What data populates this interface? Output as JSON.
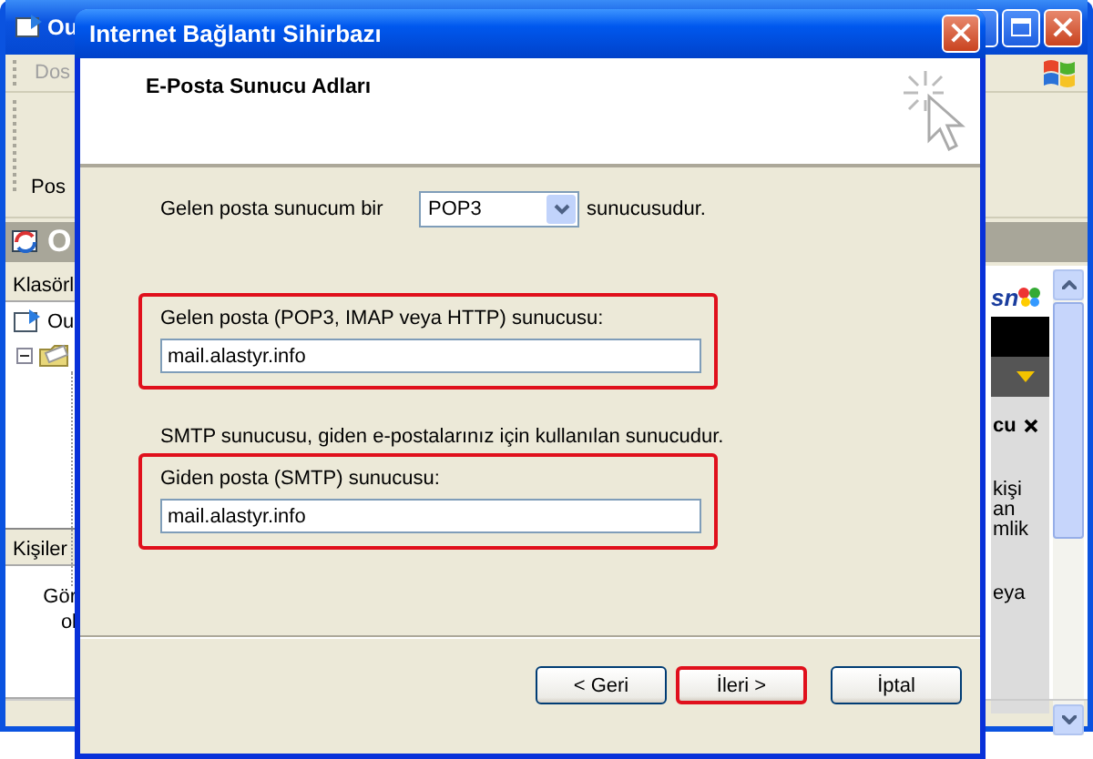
{
  "background_window": {
    "title": "Ou",
    "menu": [
      "Dos"
    ],
    "toolbar_label": "Pos",
    "header": "O",
    "folders": {
      "header": "Klasörl",
      "root": "Ou"
    },
    "contacts": {
      "header": "Kişiler",
      "lines": [
        "Gör",
        "ol"
      ]
    },
    "right_pane": {
      "logo_text": "sn",
      "title": "cu",
      "lines": [
        "kişi",
        "an",
        "mlik",
        "eya"
      ]
    }
  },
  "dialog": {
    "title": "Internet Bağlantı Sihirbazı",
    "heading": "E-Posta Sunucu Adları",
    "server_type": {
      "label": "Gelen posta sunucum bir",
      "value": "POP3",
      "suffix": "sunucusudur."
    },
    "groups": [
      {
        "kind": "field",
        "label": "Gelen posta (POP3, IMAP veya HTTP) sunucusu:",
        "value": "mail.alastyr.info",
        "highlighted": true
      },
      {
        "kind": "note",
        "text": "SMTP sunucusu, giden e-postalarınız için kullanılan sunucudur."
      },
      {
        "kind": "field",
        "label": "Giden posta (SMTP) sunucusu:",
        "value": "mail.alastyr.info",
        "highlighted": true
      }
    ],
    "buttons": [
      {
        "label": "< Geri",
        "highlighted": false
      },
      {
        "label": "İleri >",
        "highlighted": true
      },
      {
        "label": "İptal",
        "highlighted": false
      }
    ]
  }
}
